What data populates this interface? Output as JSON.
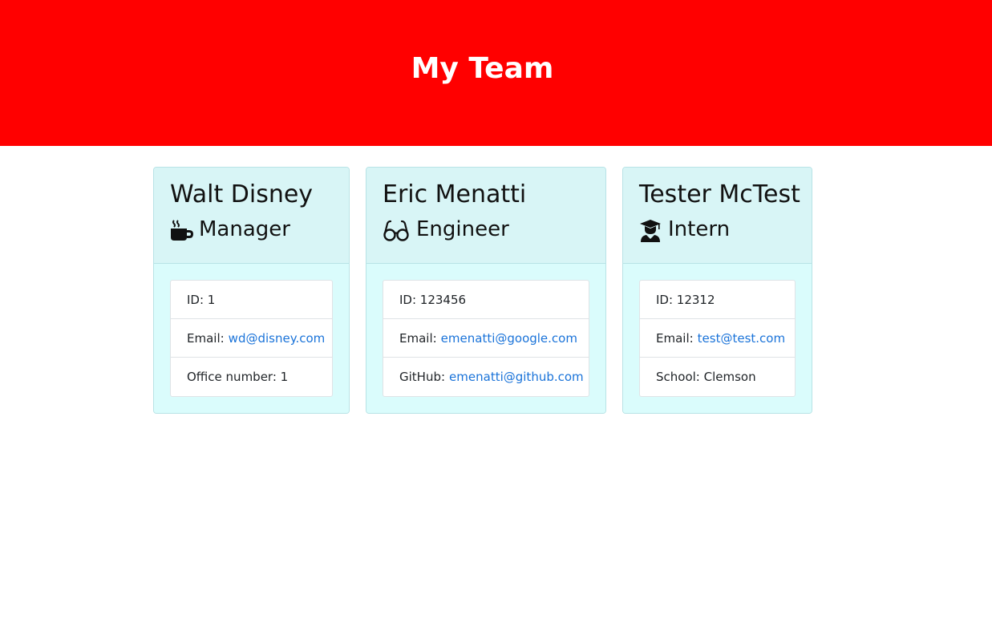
{
  "header": {
    "title": "My Team"
  },
  "team": [
    {
      "name": "Walt Disney",
      "role": "Manager",
      "icon": "mug-icon",
      "id_label": "ID: 1",
      "email_prefix": "Email:",
      "email": "wd@disney.com",
      "extra_label": "Office number: 1"
    },
    {
      "name": "Eric Menatti",
      "role": "Engineer",
      "icon": "glasses-icon",
      "id_label": "ID: 123456",
      "email_prefix": "Email:",
      "email": "emenatti@google.com",
      "extra_prefix": "GitHub:",
      "extra_link": "emenatti@github.com"
    },
    {
      "name": "Tester McTest",
      "role": "Intern",
      "icon": "graduate-icon",
      "id_label": "ID: 12312",
      "email_prefix": "Email:",
      "email": "test@test.com",
      "extra_label": "School: Clemson"
    }
  ],
  "colors": {
    "header_bg": "#ff0000",
    "card_bg": "#d7f8f8",
    "link": "#1a73d9"
  }
}
